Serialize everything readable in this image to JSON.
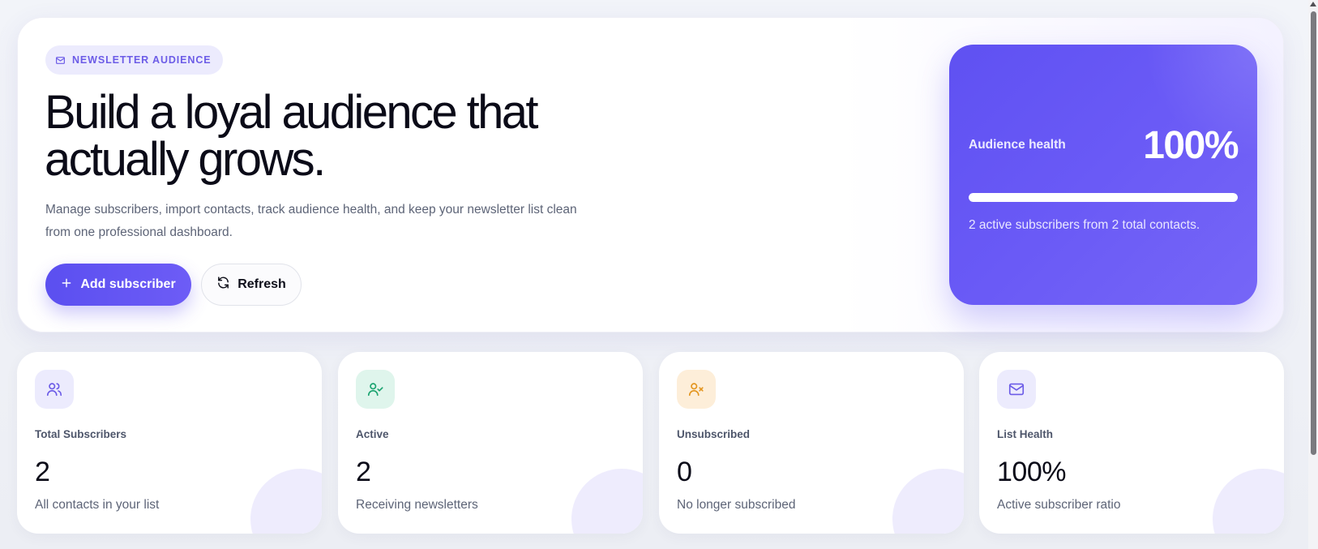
{
  "hero": {
    "badge_icon": "mail-icon",
    "badge": "NEWSLETTER AUDIENCE",
    "headline_line1": "Build a loyal audience that",
    "headline_line2": "actually grows.",
    "subtext": "Manage subscribers, import contacts, track audience health, and keep your newsletter list clean from one professional dashboard.",
    "primary_button": {
      "icon": "plus-icon",
      "label": "Add subscriber"
    },
    "secondary_button": {
      "icon": "refresh-icon",
      "label": "Refresh"
    }
  },
  "health": {
    "title": "Audience health",
    "value": "100%",
    "progress": 1.0,
    "note": "2 active subscribers from 2 total contacts."
  },
  "stats": [
    {
      "icon": "users-icon",
      "label": "Total Subscribers",
      "value": "2",
      "desc": "All contacts in your list",
      "icon_bg": "#ecebfd",
      "icon_color": "#6c5ce7"
    },
    {
      "icon": "user-check-icon",
      "label": "Active",
      "value": "2",
      "desc": "Receiving newsletters",
      "icon_bg": "#dff5ec",
      "icon_color": "#1aa36f"
    },
    {
      "icon": "user-x-icon",
      "label": "Unsubscribed",
      "value": "0",
      "desc": "No longer subscribed",
      "icon_bg": "#fdeed9",
      "icon_color": "#e3951f"
    },
    {
      "icon": "mail-icon",
      "label": "List Health",
      "value": "100%",
      "desc": "Active subscriber ratio",
      "icon_bg": "#ecebfd",
      "icon_color": "#6c5ce7"
    }
  ],
  "colors": {
    "accent": "#5f51f2",
    "accent_light": "#ecebfd",
    "text_dark": "#0b0b18",
    "text_muted": "#5d6477"
  }
}
